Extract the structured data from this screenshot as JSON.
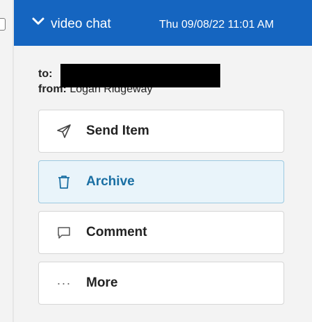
{
  "header": {
    "subject": "video chat",
    "date": "Thu 09/08/22 11:01 AM",
    "accent_color": "#1565c0"
  },
  "meta": {
    "to_label": "to:",
    "from_label": "from:",
    "from_value": "Logan Ridgeway"
  },
  "actions": [
    {
      "label": "Send Item",
      "icon": "send-icon"
    },
    {
      "label": "Archive",
      "icon": "trash-icon",
      "active": true
    },
    {
      "label": "Comment",
      "icon": "comment-icon"
    },
    {
      "label": "More",
      "icon": "more-icon"
    }
  ]
}
